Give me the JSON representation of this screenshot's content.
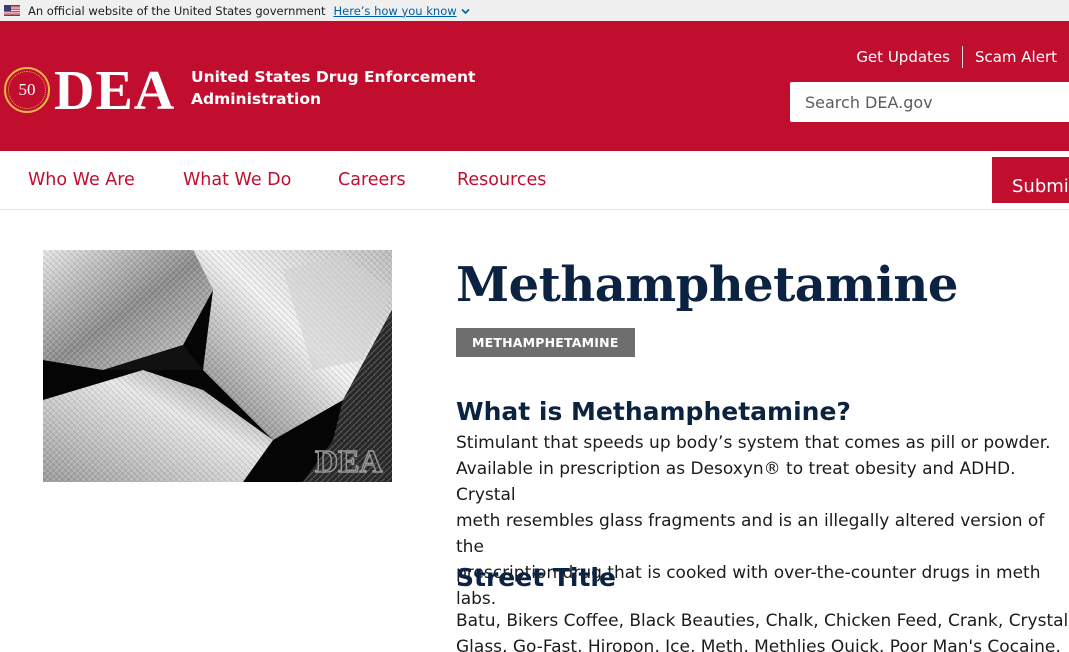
{
  "gov_banner": {
    "official_text": "An official website of the United States government",
    "how_link": "Here’s how you know"
  },
  "header": {
    "logo_seal_text": "50",
    "wordmark": "DEA",
    "agency_line1": "United States Drug Enforcement",
    "agency_line2": "Administration",
    "utility_links": [
      "Get Updates",
      "Scam Alert"
    ],
    "search_placeholder": "Search DEA.gov"
  },
  "nav": {
    "items": [
      "Who We Are",
      "What We Do",
      "Careers",
      "Resources"
    ],
    "submit_label": "Submit"
  },
  "main": {
    "image_watermark": "DEA",
    "title": "Methamphetamine",
    "tag": "METHAMPHETAMINE",
    "section1_heading": "What is Methamphetamine?",
    "section1_body_lines": [
      "Stimulant that speeds up body’s system that comes as pill or powder.",
      "Available in prescription as Desoxyn® to treat obesity and ADHD. Crystal",
      "meth resembles glass fragments and is an illegally altered version of the",
      "prescription drug that is cooked with over-the-counter drugs in meth labs."
    ],
    "section2_heading": "Street Title",
    "section2_body_lines": [
      "Batu, Bikers Coffee, Black Beauties, Chalk, Chicken Feed, Crank, Crystal,",
      "Glass, Go-Fast, Hiropon, Ice, Meth, Methlies Quick, Poor Man's Cocaine,"
    ]
  },
  "colors": {
    "brand_red": "#c10e2f",
    "navy": "#0b2340",
    "tag_gray": "#6e6e6e",
    "link_blue": "#005ea2"
  }
}
